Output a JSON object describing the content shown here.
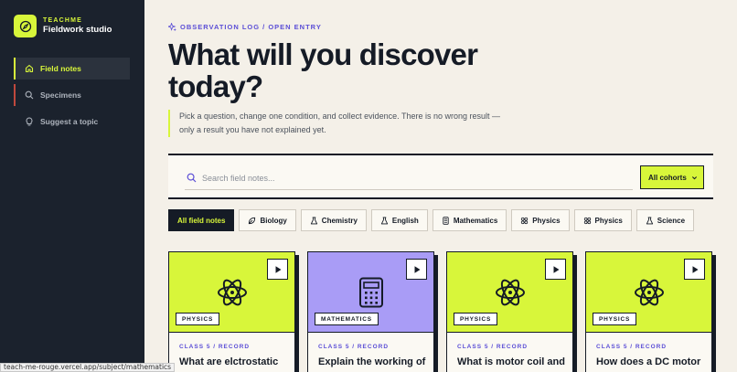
{
  "brand": {
    "kicker": "TEACHME",
    "name": "Fieldwork studio",
    "accent": "#d8f63a"
  },
  "sidebar": {
    "items": [
      {
        "label": "Field notes",
        "icon": "home-icon",
        "active": true
      },
      {
        "label": "Specimens",
        "icon": "search-icon"
      },
      {
        "label": "Suggest a topic",
        "icon": "lightbulb-icon"
      }
    ]
  },
  "header": {
    "eyebrow": "OBSERVATION LOG / OPEN ENTRY",
    "title": "What will you discover today?",
    "lead": "Pick a question, change one condition, and collect evidence. There is no wrong result — only a result you have not explained yet."
  },
  "search": {
    "placeholder": "Search field notes...",
    "value": "",
    "cohort": "All cohorts"
  },
  "filters": [
    {
      "label": "All field notes",
      "icon": "",
      "active": true
    },
    {
      "label": "Biology",
      "icon": "leaf-icon"
    },
    {
      "label": "Chemistry",
      "icon": "flask-icon"
    },
    {
      "label": "English",
      "icon": "flask-icon"
    },
    {
      "label": "Mathematics",
      "icon": "calculator-icon"
    },
    {
      "label": "Physics",
      "icon": "atom-icon"
    },
    {
      "label": "Physics",
      "icon": "atom-icon"
    },
    {
      "label": "Science",
      "icon": "flask-icon"
    }
  ],
  "cards": [
    {
      "subject": "PHYSICS",
      "meta": "CLASS 5 / RECORD",
      "title": "What are elctrostatic",
      "color": "#d8f63a",
      "icon": "atom-icon"
    },
    {
      "subject": "MATHEMATICS",
      "meta": "CLASS 5 / RECORD",
      "title": "Explain the working of",
      "color": "#a99cf6",
      "icon": "calculator-icon"
    },
    {
      "subject": "PHYSICS",
      "meta": "CLASS 5 / RECORD",
      "title": "What is motor coil and",
      "color": "#d8f63a",
      "icon": "atom-icon"
    },
    {
      "subject": "PHYSICS",
      "meta": "CLASS 5 / RECORD",
      "title": "How does a DC motor",
      "color": "#d8f63a",
      "icon": "atom-icon"
    }
  ],
  "status_url": "teach-me-rouge.vercel.app/subject/mathematics"
}
